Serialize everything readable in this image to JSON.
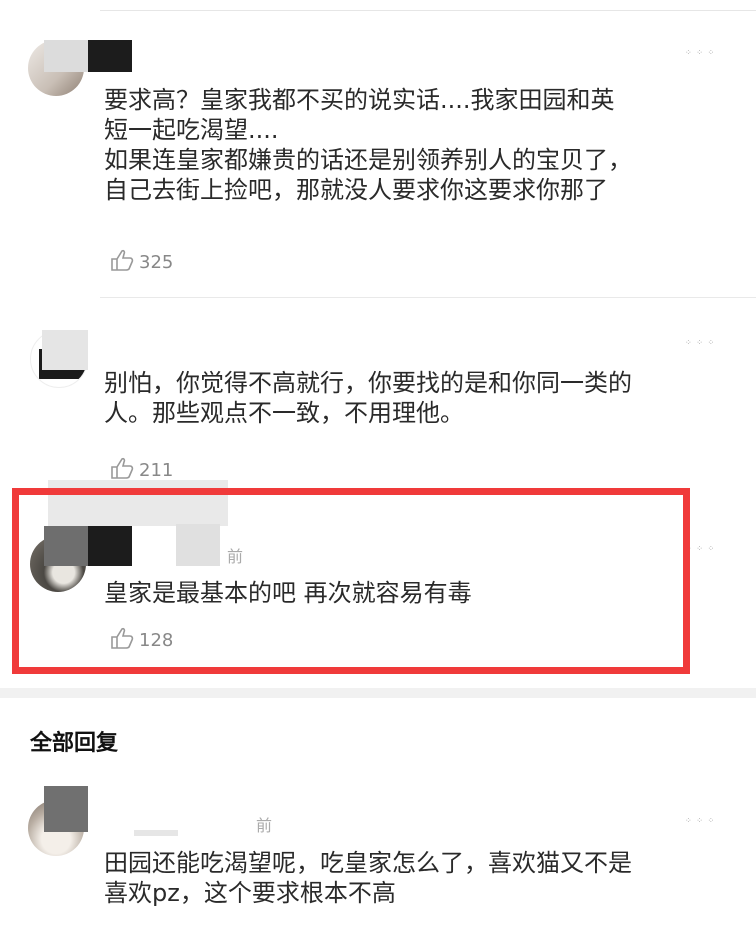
{
  "comments": [
    {
      "text_lines": [
        "要求高？皇家我都不买的说实话....我家田园和英",
        "短一起吃渴望....",
        "如果连皇家都嫌贵的话还是别领养别人的宝贝了，",
        "自己去街上捡吧，那就没人要求你这要求你那了"
      ],
      "likes": "325",
      "more": "⁘ ⁘ ⁘"
    },
    {
      "text_lines": [
        "别怕，你觉得不高就行，你要找的是和你同一类的",
        "人。那些观点不一致，不用理他。"
      ],
      "likes": "211",
      "more": "⁘ ⁘ ⁘"
    },
    {
      "text_lines": [
        "皇家是最基本的吧 再次就容易有毒"
      ],
      "likes": "128",
      "time": "前",
      "more": "⁘ ⁘ ⁘",
      "highlighted": true
    }
  ],
  "section_title": "全部回复",
  "replies": [
    {
      "text_lines": [
        "田园还能吃渴望呢，吃皇家怎么了，喜欢猫又不是",
        "喜欢pz，这个要求根本不高"
      ],
      "time": "前",
      "more": "⁘ ⁘ ⁘"
    }
  ],
  "colors": {
    "highlight_border": "#f03a3a",
    "like_text": "#888888"
  },
  "icons": {
    "like": "thumbs-up-icon",
    "more": "more-dots-icon"
  }
}
